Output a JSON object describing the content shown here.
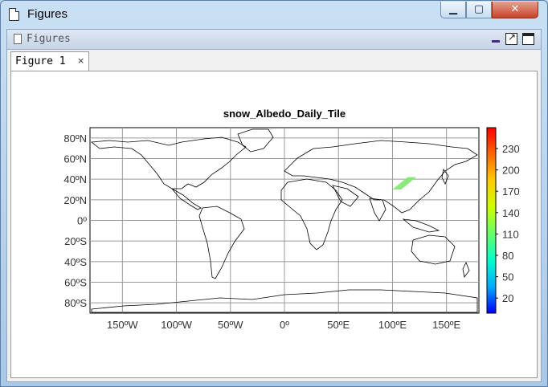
{
  "window": {
    "title": "Figures"
  },
  "panel": {
    "title": "Figures"
  },
  "tabs": [
    {
      "label": "Figure 1",
      "close": "×"
    }
  ],
  "icons": {
    "app": "document-icon",
    "minimize": "minimize-icon",
    "maximize": "maximize-icon",
    "close": "close-icon",
    "undock": "undock-icon"
  },
  "chart_data": {
    "type": "heatmap",
    "title": "snow_Albedo_Daily_Tile",
    "x_ticks": [
      "150ºW",
      "100ºW",
      "50ºW",
      "0º",
      "50ºE",
      "100ºE",
      "150ºE"
    ],
    "y_ticks": [
      "80ºN",
      "60ºN",
      "40ºN",
      "20ºN",
      "0º",
      "20ºS",
      "40ºS",
      "60ºS",
      "80ºS"
    ],
    "xlim": [
      -180,
      180
    ],
    "ylim": [
      -90,
      90
    ],
    "grid": true,
    "colorbar": {
      "ticks": [
        "230",
        "200",
        "170",
        "140",
        "110",
        "80",
        "50",
        "20"
      ],
      "colors": [
        "#0000ff",
        "#00aaff",
        "#00ffcc",
        "#66ff66",
        "#ccff00",
        "#ffcc00",
        "#ff6600",
        "#ff0000"
      ]
    },
    "data_region": {
      "lon_min": 100,
      "lon_max": 122,
      "lat_min": 30,
      "lat_max": 42,
      "color": "#7ce86a"
    }
  }
}
